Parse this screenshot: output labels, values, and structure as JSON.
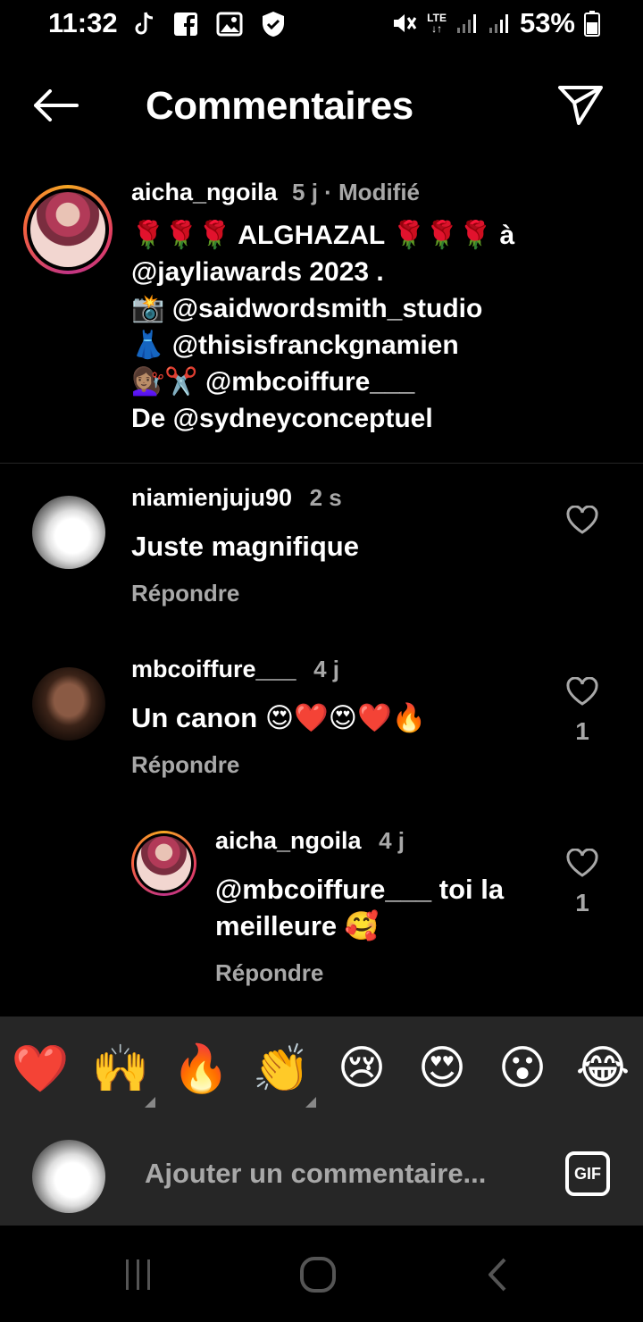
{
  "status_bar": {
    "time": "11:32",
    "network": "LTE",
    "battery_percent": "53%",
    "icons": [
      "tiktok-icon",
      "facebook-icon",
      "gallery-icon",
      "shield-icon",
      "mute-icon",
      "signal-icon",
      "signal-icon",
      "battery-icon"
    ]
  },
  "header": {
    "title": "Commentaires",
    "back_icon": "back-arrow-icon",
    "share_icon": "send-icon"
  },
  "caption": {
    "username": "aicha_ngoila",
    "meta": "5 j · Modifié",
    "lines": [
      "🌹🌹🌹 ALGHAZAL 🌹🌹🌹 à",
      "@jayliawards 2023 .",
      "📸 @saidwordsmith_studio",
      "👗 @thisisfranckgnamien",
      "💇🏽‍♀️✂️ @mbcoiffure___",
      "De @sydneyconceptuel"
    ]
  },
  "comments": [
    {
      "username": "niamienjuju90",
      "time": "2 s",
      "text": "Juste magnifique",
      "reply_label": "Répondre",
      "likes": ""
    },
    {
      "username": "mbcoiffure___",
      "time": "4 j",
      "text": "Un canon 😍❤️😍❤️🔥",
      "reply_label": "Répondre",
      "likes": "1"
    },
    {
      "username": "aicha_ngoila",
      "time": "4 j",
      "text_line1": "@mbcoiffure___ toi la",
      "text_line2": "meilleure 🥰",
      "reply_label": "Répondre",
      "likes": "1"
    }
  ],
  "emoji_bar": [
    "❤️",
    "🙌",
    "🔥",
    "👏",
    "😢",
    "😍",
    "😮",
    "😂"
  ],
  "input": {
    "placeholder": "Ajouter un commentaire...",
    "gif_label": "GIF"
  },
  "nav": {
    "icons": [
      "recent-apps-icon",
      "home-icon",
      "back-icon"
    ]
  }
}
